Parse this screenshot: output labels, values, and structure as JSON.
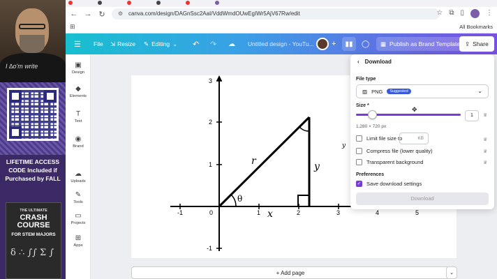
{
  "stream": {
    "shirt_text": "I ∆o'm write",
    "promo": [
      "LIFETIME ACCESS",
      "CODE Included if",
      "Purchased by FALL"
    ],
    "book": {
      "line1": "THE ULTIMATE",
      "line2": "CRASH COURSE",
      "line3": "FOR STEM MAJORS",
      "symbols": "δ ∴ ∫∫ Σ ∫"
    }
  },
  "browser": {
    "url": "canva.com/design/DAGnSsc2AaI/VddWmdOUwEgIWr5AjV67Rw/edit",
    "all_bookmarks": "All Bookmarks"
  },
  "toolbar": {
    "file": "File",
    "resize": "Resize",
    "editing": "Editing",
    "title": "Untitled design - YouTu...",
    "publish": "Publish as Brand Template",
    "share": "Share"
  },
  "rail": [
    {
      "icon": "design-icon",
      "glyph": "▣",
      "label": "Design"
    },
    {
      "icon": "elements-icon",
      "glyph": "◆",
      "label": "Elements"
    },
    {
      "icon": "text-icon",
      "glyph": "T",
      "label": "Text"
    },
    {
      "icon": "brand-icon",
      "glyph": "◉",
      "label": "Brand"
    },
    {
      "icon": "uploads-icon",
      "glyph": "☁",
      "label": "Uploads"
    },
    {
      "icon": "tools-icon",
      "glyph": "✎",
      "label": "Tools"
    },
    {
      "icon": "projects-icon",
      "glyph": "▭",
      "label": "Projects"
    },
    {
      "icon": "apps-icon",
      "glyph": "⊞",
      "label": "Apps"
    }
  ],
  "graph": {
    "x_ticks": [
      "-1",
      "0",
      "1",
      "2",
      "3",
      "4",
      "5"
    ],
    "y_ticks": [
      "3",
      "2",
      "1",
      "-1"
    ],
    "labels": {
      "r": "r",
      "y": "y",
      "theta": "θ",
      "x": "x",
      "y_side": "y"
    }
  },
  "download": {
    "title": "Download",
    "file_type_label": "File type",
    "file_type": "PNG",
    "suggested": "Suggested",
    "size_label": "Size ",
    "size_required": "*",
    "size_value": "1",
    "size_scale": 0.15,
    "dims": "1,280 × 720 px",
    "limit_size": "Limit file size to",
    "kb": "KB",
    "compress": "Compress file (lower quality)",
    "transparent": "Transparent background",
    "preferences": "Preferences",
    "save_settings": "Save download settings",
    "button": "Download"
  },
  "add_page": "+ Add page",
  "colors": {
    "accent": "#7a3ad8",
    "toolbar_start": "#17bfd0",
    "toolbar_end": "#7a4fe0"
  }
}
